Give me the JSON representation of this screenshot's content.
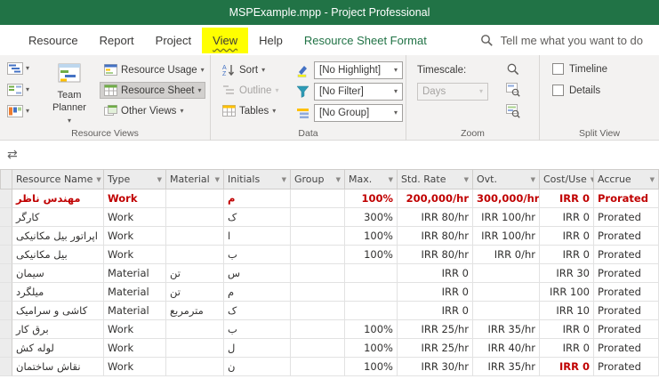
{
  "colors": {
    "brand_green": "#217346",
    "menu_highlight": "#ffff00",
    "alert_red": "#c00000"
  },
  "icons": {
    "chevron": "▾",
    "filter_arrow": "▼",
    "swap": "⇄"
  },
  "titlebar": {
    "title": "MSPExample.mpp  -  Project Professional"
  },
  "menu": {
    "items": [
      {
        "label": "Resource"
      },
      {
        "label": "Report"
      },
      {
        "label": "Project"
      },
      {
        "label": "View"
      },
      {
        "label": "Help"
      },
      {
        "label": "Resource Sheet Format"
      }
    ],
    "search_placeholder": "Tell me what you want to do"
  },
  "ribbon": {
    "group_labels": [
      "Resource Views",
      "Data",
      "Zoom",
      "Split View"
    ],
    "buttons": {
      "team_planner": "Team Planner",
      "resource_usage": "Resource Usage",
      "resource_sheet": "Resource Sheet",
      "other_views": "Other Views",
      "sort": "Sort",
      "outline": "Outline",
      "tables": "Tables",
      "highlight_value": "[No Highlight]",
      "filter_value": "[No Filter]",
      "group_value": "[No Group]",
      "timescale_label": "Timescale:",
      "timescale_value": "Days",
      "timeline": "Timeline",
      "details": "Details"
    }
  },
  "table": {
    "columns": [
      {
        "label": "Resource Name",
        "align": "left"
      },
      {
        "label": "Type",
        "align": "left"
      },
      {
        "label": "Material",
        "align": "left"
      },
      {
        "label": "Initials",
        "align": "left"
      },
      {
        "label": "Group",
        "align": "left"
      },
      {
        "label": "Max.",
        "align": "right"
      },
      {
        "label": "Std. Rate",
        "align": "right"
      },
      {
        "label": "Ovt.",
        "align": "right"
      },
      {
        "label": "Cost/Use",
        "align": "right"
      },
      {
        "label": "Accrue",
        "align": "left"
      }
    ],
    "rows": [
      {
        "cells": [
          "مهندس ناظر",
          "Work",
          "",
          "م",
          "",
          "100%",
          "200,000/hr",
          "300,000/hr",
          "IRR 0",
          "Prorated"
        ],
        "style": "red"
      },
      {
        "cells": [
          "کارگر",
          "Work",
          "",
          "ک",
          "",
          "300%",
          "IRR 80/hr",
          "IRR 100/hr",
          "IRR 0",
          "Prorated"
        ]
      },
      {
        "cells": [
          "اپراتور بیل مکانیکی",
          "Work",
          "",
          "ا",
          "",
          "100%",
          "IRR 80/hr",
          "IRR 100/hr",
          "IRR 0",
          "Prorated"
        ]
      },
      {
        "cells": [
          "بیل مکانیکی",
          "Work",
          "",
          "ب",
          "",
          "100%",
          "IRR 80/hr",
          "IRR 0/hr",
          "IRR 0",
          "Prorated"
        ]
      },
      {
        "cells": [
          "سیمان",
          "Material",
          "تن",
          "س",
          "",
          "",
          "IRR 0",
          "",
          "IRR 30",
          "Prorated"
        ]
      },
      {
        "cells": [
          "میلگرد",
          "Material",
          "تن",
          "م",
          "",
          "",
          "IRR 0",
          "",
          "IRR 100",
          "Prorated"
        ]
      },
      {
        "cells": [
          "کاشی و سرامیک",
          "Material",
          "مترمربع",
          "ک",
          "",
          "",
          "IRR 0",
          "",
          "IRR 10",
          "Prorated"
        ]
      },
      {
        "cells": [
          "برق کار",
          "Work",
          "",
          "ب",
          "",
          "100%",
          "IRR 25/hr",
          "IRR 35/hr",
          "IRR 0",
          "Prorated"
        ]
      },
      {
        "cells": [
          "لوله کش",
          "Work",
          "",
          "ل",
          "",
          "100%",
          "IRR 25/hr",
          "IRR 40/hr",
          "IRR 0",
          "Prorated"
        ]
      },
      {
        "cells": [
          "نقاش ساختمان",
          "Work",
          "",
          "ن",
          "",
          "100%",
          "IRR 30/hr",
          "IRR 35/hr",
          "IRR 0",
          "Prorated"
        ],
        "red_cells": [
          8
        ]
      }
    ]
  }
}
